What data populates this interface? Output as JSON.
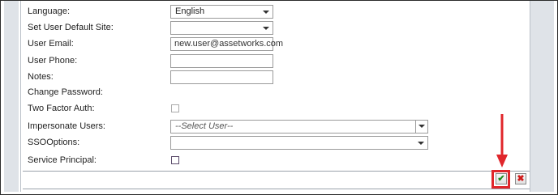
{
  "form": {
    "language": {
      "label": "Language:",
      "value": "English"
    },
    "default_site": {
      "label": "Set User Default Site:",
      "value": ""
    },
    "email": {
      "label": "User Email:",
      "value": "new.user@assetworks.com"
    },
    "phone": {
      "label": "User Phone:",
      "value": ""
    },
    "notes": {
      "label": "Notes:",
      "value": ""
    },
    "change_password": {
      "label": "Change Password:"
    },
    "two_factor": {
      "label": "Two Factor Auth:",
      "checked": false
    },
    "impersonate": {
      "label": "Impersonate Users:",
      "placeholder": "--Select User--"
    },
    "sso": {
      "label": "SSOOptions:",
      "value": ""
    },
    "service_principal": {
      "label": "Service Principal:",
      "checked": false
    }
  },
  "actions": {
    "save_glyph": "✔",
    "cancel_glyph": "✖"
  },
  "colors": {
    "annotation": "#e0262b",
    "save": "#1a8a1a",
    "cancel": "#d01c1c"
  }
}
